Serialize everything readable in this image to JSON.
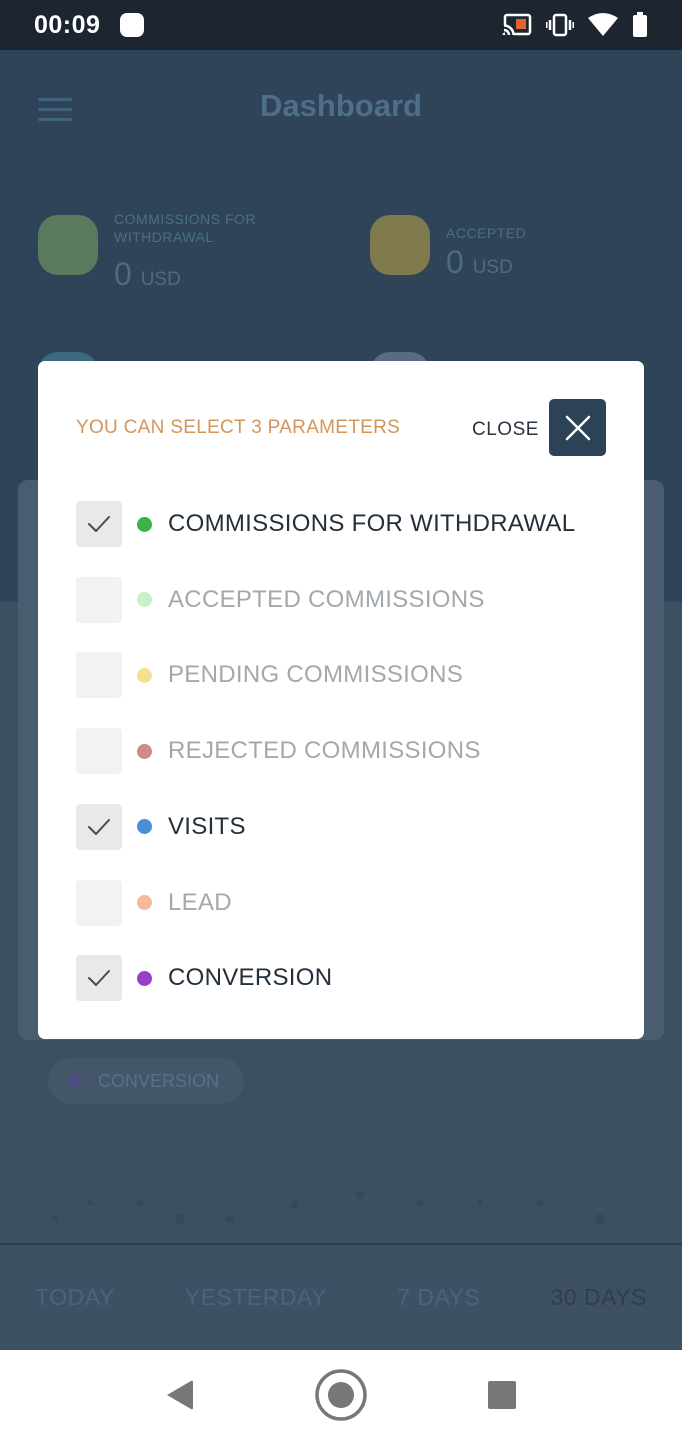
{
  "status_bar": {
    "time": "00:09",
    "icons": [
      "notification-dot-icon",
      "cast-icon",
      "vibrate-icon",
      "wifi-icon",
      "battery-icon"
    ]
  },
  "app": {
    "title": "Dashboard",
    "cards": [
      {
        "label_line1": "COMMISSIONS FOR",
        "label_line2": "WITHDRAWAL",
        "value": "0",
        "unit": "USD",
        "color": "#5a7a5e"
      },
      {
        "label_line1": "ACCEPTED",
        "label_line2": "",
        "value": "0",
        "unit": "USD",
        "color": "#7f7a4e"
      }
    ],
    "legend_chip": "CONVERSION",
    "periods": [
      "TODAY",
      "YESTERDAY",
      "7 DAYS",
      "30 DAYS"
    ],
    "active_period": "30 DAYS"
  },
  "modal": {
    "hint": "YOU CAN SELECT 3 PARAMETERS",
    "close_label": "CLOSE",
    "options": [
      {
        "label": "COMMISSIONS FOR WITHDRAWAL",
        "checked": true,
        "color": "#3ab34a"
      },
      {
        "label": "ACCEPTED COMMISSIONS",
        "checked": false,
        "color": "#c9f0c8"
      },
      {
        "label": "PENDING COMMISSIONS",
        "checked": false,
        "color": "#f7df92"
      },
      {
        "label": "REJECTED COMMISSIONS",
        "checked": false,
        "color": "#cf8a8e"
      },
      {
        "label": "VISITS",
        "checked": true,
        "color": "#4a8ed8"
      },
      {
        "label": "LEAD",
        "checked": false,
        "color": "#f7b99c"
      },
      {
        "label": "CONVERSION",
        "checked": true,
        "color": "#9a40c8"
      }
    ]
  },
  "nav_bar": {
    "buttons": [
      "back-icon",
      "home-icon",
      "recents-icon"
    ]
  }
}
